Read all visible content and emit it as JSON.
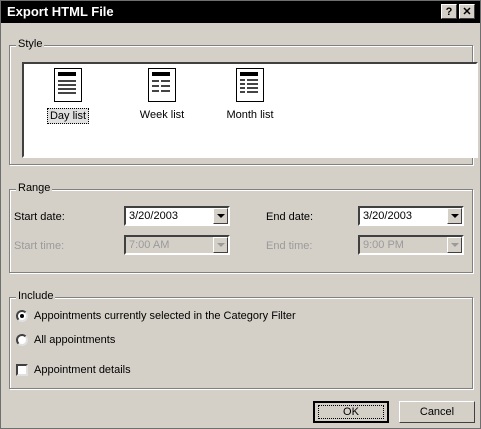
{
  "window": {
    "title": "Export HTML File",
    "help_glyph": "?",
    "close_glyph": "✕"
  },
  "style_group": {
    "label": "Style",
    "options": [
      {
        "label": "Day list",
        "icon": "day-list-icon",
        "selected": true
      },
      {
        "label": "Week list",
        "icon": "week-list-icon",
        "selected": false
      },
      {
        "label": "Month list",
        "icon": "month-list-icon",
        "selected": false
      }
    ]
  },
  "range_group": {
    "label": "Range",
    "start_date_label": "Start date:",
    "start_date_value": "3/20/2003",
    "end_date_label": "End date:",
    "end_date_value": "3/20/2003",
    "start_time_label": "Start time:",
    "start_time_value": "7:00 AM",
    "end_time_label": "End time:",
    "end_time_value": "9:00 PM"
  },
  "include_group": {
    "label": "Include",
    "option_selected": "Appointments currently selected in the Category Filter",
    "option_all": "All appointments",
    "details": "Appointment details",
    "details_checked": false
  },
  "buttons": {
    "ok": "OK",
    "cancel": "Cancel"
  }
}
